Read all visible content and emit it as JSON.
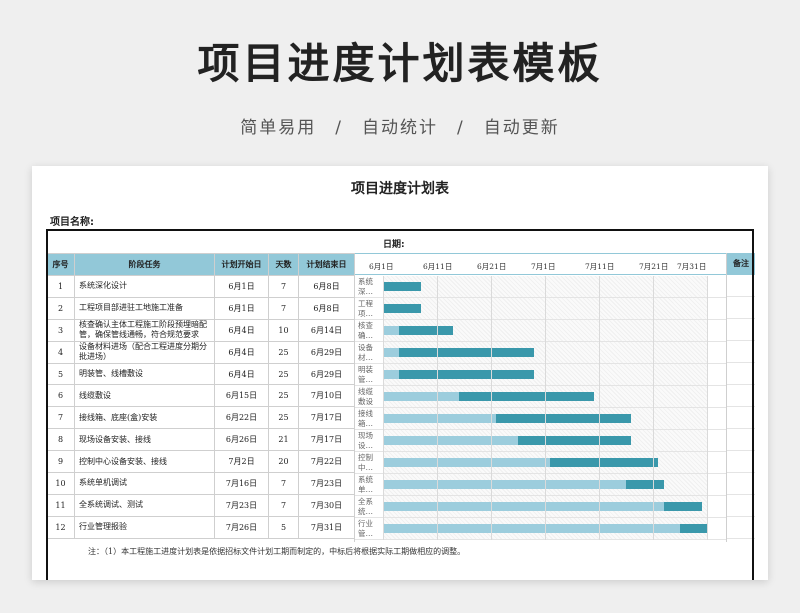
{
  "hero": {
    "title": "项目进度计划表模板",
    "subtitle": "简单易用　/　自动统计　/　自动更新"
  },
  "sheet": {
    "title": "项目进度计划表",
    "project_label": "项目名称:",
    "date_label": "日期:",
    "headers": {
      "seq": "序号",
      "task": "阶段任务",
      "start": "计划开始日",
      "days": "天数",
      "end": "计划结束日",
      "remark": "备注"
    },
    "ticks": [
      "6月1日",
      "6月11日",
      "6月21日",
      "7月1日",
      "7月11日",
      "7月21日",
      "7月31日"
    ],
    "tasks": [
      {
        "seq": "1",
        "name": "系统深化设计",
        "short": "系统深…",
        "start": "6月1日",
        "days": "7",
        "end": "6月8日",
        "plan_start": 0,
        "actual_start": 0,
        "duration": 7
      },
      {
        "seq": "2",
        "name": "工程项目部进驻工地施工准备",
        "short": "工程项…",
        "start": "6月1日",
        "days": "7",
        "end": "6月8日",
        "plan_start": 0,
        "actual_start": 0,
        "duration": 7
      },
      {
        "seq": "3",
        "name": "核查确认主体工程施工阶段预埋暗配管，确保管线通畅，符合规范要求",
        "short": "核查确…",
        "start": "6月4日",
        "days": "10",
        "end": "6月14日",
        "plan_start": 0,
        "actual_start": 3,
        "duration": 10
      },
      {
        "seq": "4",
        "name": "设备材料进场（配合工程进度分期分批进场）",
        "short": "设备材…",
        "start": "6月4日",
        "days": "25",
        "end": "6月29日",
        "plan_start": 0,
        "actual_start": 3,
        "duration": 25
      },
      {
        "seq": "5",
        "name": "明装管、线槽敷设",
        "short": "明装管…",
        "start": "6月4日",
        "days": "25",
        "end": "6月29日",
        "plan_start": 0,
        "actual_start": 3,
        "duration": 25
      },
      {
        "seq": "6",
        "name": "线缆敷设",
        "short": "线缆敷设",
        "start": "6月15日",
        "days": "25",
        "end": "7月10日",
        "plan_start": 0,
        "actual_start": 14,
        "duration": 25
      },
      {
        "seq": "7",
        "name": "接线箱、底座(盒)安装",
        "short": "接线箱…",
        "start": "6月22日",
        "days": "25",
        "end": "7月17日",
        "plan_start": 0,
        "actual_start": 21,
        "duration": 25
      },
      {
        "seq": "8",
        "name": "现场设备安装、接线",
        "short": "现场设…",
        "start": "6月26日",
        "days": "21",
        "end": "7月17日",
        "plan_start": 0,
        "actual_start": 25,
        "duration": 21
      },
      {
        "seq": "9",
        "name": "控制中心设备安装、接线",
        "short": "控制中…",
        "start": "7月2日",
        "days": "20",
        "end": "7月22日",
        "plan_start": 0,
        "actual_start": 31,
        "duration": 20
      },
      {
        "seq": "10",
        "name": "系统单机调试",
        "short": "系统单…",
        "start": "7月16日",
        "days": "7",
        "end": "7月23日",
        "plan_start": 0,
        "actual_start": 45,
        "duration": 7
      },
      {
        "seq": "11",
        "name": "全系统调试、测试",
        "short": "全系统…",
        "start": "7月23日",
        "days": "7",
        "end": "7月30日",
        "plan_start": 0,
        "actual_start": 52,
        "duration": 7
      },
      {
        "seq": "12",
        "name": "行业管理报验",
        "short": "行业管…",
        "start": "7月26日",
        "days": "5",
        "end": "7月31日",
        "plan_start": 0,
        "actual_start": 55,
        "duration": 5
      }
    ],
    "note": "注：（1）本工程施工进度计划表是依据招标文件计划工期而制定的，中标后将根据实际工期做相应的调整。",
    "colors": {
      "header": "#92c8d8",
      "plan_bar": "#9ccddd",
      "actual_bar": "#3a98ab"
    }
  }
}
